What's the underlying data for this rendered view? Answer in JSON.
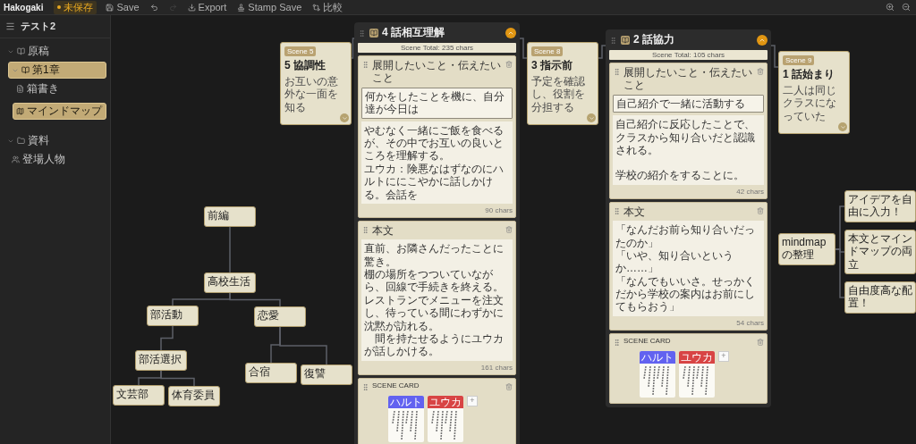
{
  "toolbar": {
    "app_name": "Hakogaki",
    "status": "未保存",
    "items": [
      {
        "kind": "save",
        "label": "Save",
        "disabled": false
      },
      {
        "kind": "undo",
        "disabled": false
      },
      {
        "kind": "redo",
        "disabled": true
      },
      {
        "kind": "export",
        "label": "Export",
        "disabled": false
      },
      {
        "kind": "stamp",
        "label": "Stamp Save",
        "disabled": false
      },
      {
        "kind": "compare",
        "label": "比較",
        "disabled": false
      }
    ]
  },
  "sidebar": {
    "title": "テスト2",
    "groups": [
      {
        "label": "原稿",
        "kind": "book",
        "expanded": true,
        "children": [
          {
            "label": "第1章",
            "kind": "book",
            "expanded": true,
            "selected": true,
            "children": [
              {
                "label": "箱書き",
                "kind": "doc",
                "selected": false
              },
              {
                "label": "マインドマップ",
                "kind": "map",
                "selected": true
              }
            ]
          }
        ]
      },
      {
        "label": "資料",
        "kind": "folder",
        "expanded": true,
        "children": [
          {
            "label": "登場人物",
            "kind": "people",
            "selected": false
          }
        ]
      }
    ]
  },
  "canvas": {
    "storyline": [
      {
        "kind": "scene",
        "badge": "Scene 5",
        "title": "5 協調性",
        "summary": "お互いの意外な一面を知る"
      },
      {
        "kind": "column",
        "title": "4 話相互理解",
        "total": "Scene Total: 235 chars",
        "sections": [
          {
            "kind": "plot",
            "heading": "展開したいこと・伝えたいこと",
            "field": "何かをしたことを機に、自分達が今日は",
            "body": [
              {
                "text": "やむなく一緒にご飯を食べるが、その中でお互いの良いところを理解する。",
                "gap": false
              },
              {
                "text": "ユウカ：険悪なはずなのにハルトににこやかに話しかける。会話を",
                "gap": false
              }
            ],
            "count": "90 chars"
          },
          {
            "kind": "text",
            "heading": "本文",
            "body": [
              {
                "text": "直前、お隣さんだったことに驚き。",
                "gap": false
              },
              {
                "text": "棚の場所をつついていながら、回線で手続きを終える。",
                "gap": false
              },
              {
                "text": "レストランでメニューを注文し、待っている間にわずかに沈黙が訪れる。",
                "gap": false
              },
              {
                "text": "　間を持たせるようにユウカが話しかける。",
                "gap": false
              }
            ],
            "count": "161 chars"
          },
          {
            "kind": "cards",
            "heading": "SCENE CARD",
            "add": "+",
            "cards": [
              {
                "name": "ハルト",
                "color": "#6262f0"
              },
              {
                "name": "ユウカ",
                "color": "#d84444"
              }
            ]
          }
        ]
      },
      {
        "kind": "scene",
        "badge": "Scene 8",
        "title": "3 指示前",
        "summary": "予定を確認し、役割を分担する"
      },
      {
        "kind": "column",
        "title": "2 話協力",
        "total": "Scene Total: 105 chars",
        "sections": [
          {
            "kind": "plot",
            "heading": "展開したいこと・伝えたいこと",
            "field": "自己紹介で一緒に活動する",
            "body": [
              {
                "text": "自己紹介に反応したことで、クラスから知り合いだと認識される。",
                "gap": false
              },
              {
                "text": "学校の紹介をすることに。",
                "gap": true
              }
            ],
            "count": "42 chars"
          },
          {
            "kind": "text",
            "heading": "本文",
            "body": [
              {
                "text": "「なんだお前ら知り合いだったのか」",
                "gap": false
              },
              {
                "text": "「いや、知り合いというか……」",
                "gap": false
              },
              {
                "text": "「なんでもいいさ。せっかくだから学校の案内はお前にしてもらおう」",
                "gap": false
              }
            ],
            "count": "54 chars"
          },
          {
            "kind": "cards",
            "heading": "SCENE CARD",
            "add": "+",
            "cards": [
              {
                "name": "ハルト",
                "color": "#6262f0"
              },
              {
                "name": "ユウカ",
                "color": "#d84444"
              }
            ]
          }
        ]
      },
      {
        "kind": "scene",
        "badge": "Scene 9",
        "title": "1 話始まり",
        "summary": "二人は同じクラスになっていた"
      }
    ],
    "mindmaps": [
      {
        "label": "前編",
        "children": [
          {
            "label": "高校生活",
            "children": [
              {
                "label": "部活動",
                "children": [
                  {
                    "label": "部活選択",
                    "children": [
                      {
                        "label": "文芸部"
                      },
                      {
                        "label": "体育委員"
                      }
                    ]
                  }
                ]
              },
              {
                "label": "恋愛",
                "children": [
                  {
                    "label": "合宿"
                  },
                  {
                    "label": "復讐"
                  }
                ]
              }
            ]
          }
        ]
      },
      {
        "label": "mindmapの整理",
        "children": [
          {
            "label": "アイデアを自由に入力！"
          },
          {
            "label": "本文とマインドマップの両立"
          },
          {
            "label": "自由度高な配置！"
          }
        ]
      }
    ]
  }
}
